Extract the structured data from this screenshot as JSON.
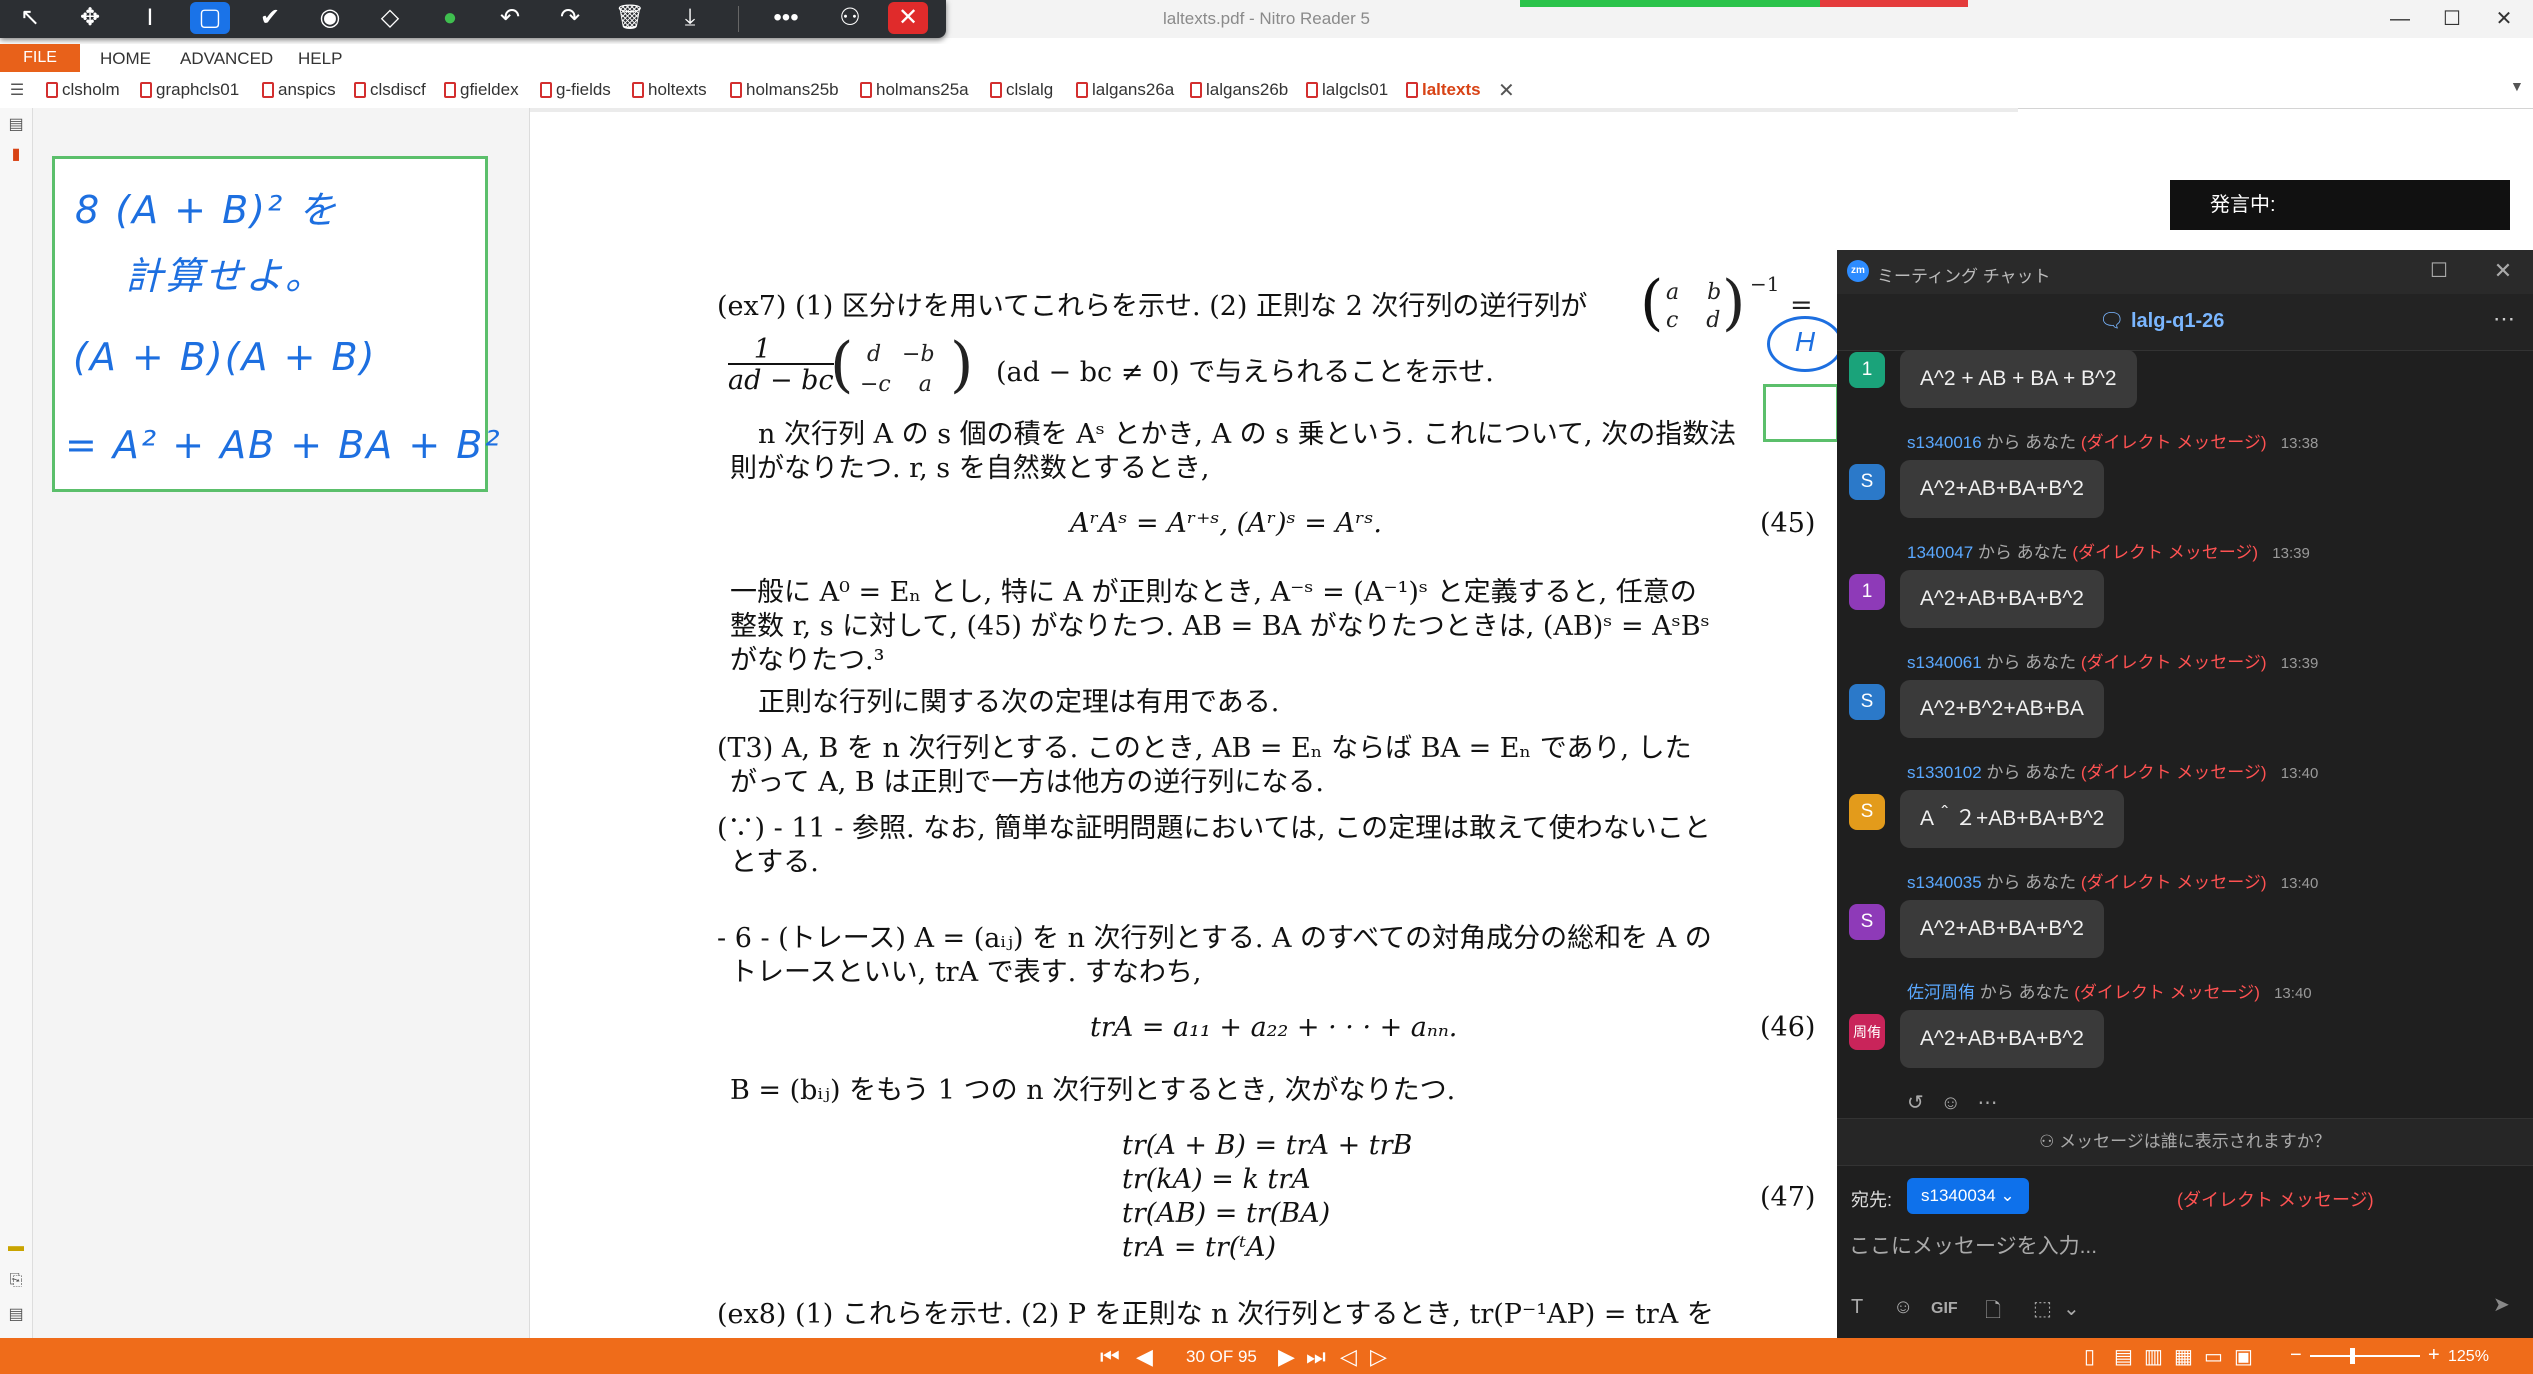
{
  "window": {
    "title": "laltexts.pdf - Nitro Reader 5",
    "minimize": "—",
    "maximize": "☐",
    "close": "✕"
  },
  "annotation_toolbar": {
    "icons": [
      "pointer-icon",
      "move-icon",
      "text-cursor-icon",
      "rectangle-icon",
      "check-icon",
      "stamp-icon",
      "eraser-icon",
      "green-dot-icon",
      "undo-icon",
      "redo-icon",
      "trash-icon",
      "download-icon",
      "more-icon",
      "share-icon",
      "stop-icon"
    ],
    "glyphs": [
      "↖",
      "✥",
      "I",
      "▢",
      "✔",
      "◉",
      "◇",
      "●",
      "↶",
      "↷",
      "🗑",
      "⤓",
      "•••",
      "⚇",
      "✕"
    ]
  },
  "menu": {
    "file": "FILE",
    "home": "HOME",
    "advanced": "ADVANCED",
    "help": "HELP"
  },
  "tabs": [
    "clsholm",
    "graphcls01",
    "anspics",
    "clsdiscf",
    "gfieldex",
    "g-fields",
    "holtexts",
    "holmans25b",
    "holmans25a",
    "clslalg",
    "lalgans26a",
    "lalgans26b",
    "lalgcls01",
    "laltexts"
  ],
  "whiteboard": {
    "line1": "8 (A + B)² を",
    "line2": "計算せよ。",
    "line3": "(A + B)(A + B)",
    "line4": "= A² + AB + BA + B²"
  },
  "document": {
    "annotation_h": "H",
    "ex7_line1": "(ex7)  (1) 区分けを用いてこれらを示せ.   (2) 正則な 2 次行列の逆行列が",
    "ex7_line2": "(ad − bc ≠ 0) で与えられることを示せ.",
    "para1_line1": "n 次行列 A の s 個の積を Aˢ とかき, A の s 乗という. これについて, 次の指数法",
    "para1_line2": "則がなりたつ. r, s を自然数とするとき,",
    "eq45": "AʳAˢ = Aʳ⁺ˢ,        (Aʳ)ˢ = Aʳˢ.",
    "eq45_num": "(45)",
    "para2_line1": "一般に A⁰ = Eₙ とし, 特に A が正則なとき, A⁻ˢ = (A⁻¹)ˢ と定義すると, 任意の",
    "para2_line2": "整数 r, s に対して, (45) がなりたつ. AB = BA がなりたつときは, (AB)ˢ = AˢBˢ",
    "para2_line3": "がなりたつ.³",
    "para3": "正則な行列に関する次の定理は有用である.",
    "t3_line1": "(T3)  A, B を n 次行列とする. このとき, AB = Eₙ ならば BA = Eₙ であり, した",
    "t3_line2": "がって A, B は正則で一方は他方の逆行列になる.",
    "because_line1": "(∵) - 11 - 参照. なお, 簡単な証明問題においては, この定理は敢えて使わないこと",
    "because_line2": "とする.",
    "sec6_line1": "- 6 - (トレース) A = (aᵢⱼ) を n 次行列とする. A のすべての対角成分の総和を A の",
    "sec6_line2": "トレースといい, trA で表す. すなわち,",
    "eq46": "trA = a₁₁ + a₂₂ + · · · + aₙₙ.",
    "eq46_num": "(46)",
    "para4": "B = (bᵢⱼ) をもう 1 つの n 次行列とするとき, 次がなりたつ.",
    "eq47": [
      "tr(A + B) = trA + trB",
      "tr(kA) = k trA",
      "tr(AB) = tr(BA)",
      "trA = tr(ᵗA)"
    ],
    "eq47_num": "(47)",
    "ex8_line1": "(ex8)  (1) これらを示せ.   (2) P を正則な n 次行列とするとき, tr(P⁻¹AP) = trA を"
  },
  "speaking": {
    "label": "発言中:"
  },
  "chat": {
    "window_title": "ミーティング チャット",
    "logo": "zm",
    "name": "lalg-q1-26",
    "messages": [
      {
        "avatar": "1",
        "avatar_color": "#1aa37a",
        "sender": "",
        "text": "A^2 + AB + BA + B^2",
        "time": ""
      },
      {
        "avatar": "S",
        "avatar_color": "#2b79c9",
        "sender": "s1340016",
        "text": "A^2+AB+BA+B^2",
        "time": "13:38"
      },
      {
        "avatar": "1",
        "avatar_color": "#8e3ab8",
        "sender": "1340047",
        "text": "A^2+AB+BA+B^2",
        "time": "13:39"
      },
      {
        "avatar": "S",
        "avatar_color": "#2b79c9",
        "sender": "s1340061",
        "text": "A^2+B^2+AB+BA",
        "time": "13:39"
      },
      {
        "avatar": "S",
        "avatar_color": "#e39b1b",
        "sender": "s1330102",
        "text": "A＾２+AB+BA+B^2",
        "time": "13:40"
      },
      {
        "avatar": "S",
        "avatar_color": "#8e3ab8",
        "sender": "s1340035",
        "text": "A^2+AB+BA+B^2",
        "time": "13:40"
      },
      {
        "avatar": "周侑",
        "avatar_color": "#c9245a",
        "sender": "佐河周侑",
        "text": "A^2+AB+BA+B^2",
        "time": "13:40"
      }
    ],
    "from_you": "から あなた",
    "dm": "(ダイレクト メッセージ)",
    "visibility": "メッセージは誰に表示されますか？",
    "to_label": "宛先:",
    "to_value": "s1340034",
    "to_dm": "(ダイレクト メッセージ)",
    "input_placeholder": "ここにメッセージを入力...",
    "composer_icons": [
      "text-format-icon",
      "emoji-icon",
      "gif-icon",
      "file-icon",
      "screenshot-icon",
      "chevron-down-icon"
    ],
    "composer_glyphs": [
      "T",
      "☺",
      "GIF",
      "🗋",
      "⬚",
      "⌄"
    ]
  },
  "statusbar": {
    "page": "30 OF 95",
    "zoom": "125%"
  }
}
